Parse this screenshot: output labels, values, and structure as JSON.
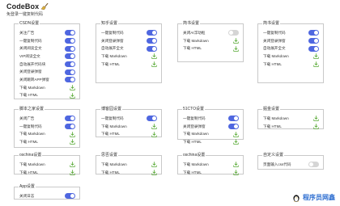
{
  "app": {
    "title": "CodeBox",
    "subtitle": "免登录一键复制代码"
  },
  "icons": {
    "logo": "broom-icon",
    "download": "download-icon",
    "brand": "penguin-icon"
  },
  "colors": {
    "toggle_on": "#4f67e0",
    "toggle_off": "#d5d5d5",
    "download": "#55a832",
    "brand": "#2f6fd1"
  },
  "cards": [
    {
      "title": "CSDN设置",
      "rows": [
        {
          "label": "关注广告",
          "type": "toggle",
          "on": true
        },
        {
          "label": "一键复制代码",
          "type": "toggle",
          "on": true
        },
        {
          "label": "关闭阅读全文",
          "type": "toggle",
          "on": true
        },
        {
          "label": "VIP阅读全文",
          "type": "toggle",
          "on": true
        },
        {
          "label": "自动展开代码块",
          "type": "toggle",
          "on": true
        },
        {
          "label": "关闭登录弹窗",
          "type": "toggle",
          "on": true
        },
        {
          "label": "关闭跳转APP弹窗",
          "type": "toggle",
          "on": true
        },
        {
          "label": "下载 Markdown",
          "type": "download"
        },
        {
          "label": "下载 HTML",
          "type": "download"
        }
      ]
    },
    {
      "title": "知乎设置",
      "rows": [
        {
          "label": "一键复制代码",
          "type": "toggle",
          "on": true
        },
        {
          "label": "关闭登录弹窗",
          "type": "toggle",
          "on": true
        },
        {
          "label": "自动展开全文",
          "type": "toggle",
          "on": true
        },
        {
          "label": "下载 Markdown",
          "type": "download"
        },
        {
          "label": "下载 HTML",
          "type": "download"
        }
      ]
    },
    {
      "title": "简书设置",
      "rows": [
        {
          "label": "关闭AI浮动框",
          "type": "toggle",
          "on": false
        },
        {
          "label": "下载 Markdown",
          "type": "download"
        },
        {
          "label": "下载 HTML",
          "type": "download"
        }
      ]
    },
    {
      "title": "简书设置",
      "rows": [
        {
          "label": "一键复制代码",
          "type": "toggle",
          "on": true
        },
        {
          "label": "关闭登录弹窗",
          "type": "toggle",
          "on": true
        },
        {
          "label": "自动展开全文",
          "type": "toggle",
          "on": true
        },
        {
          "label": "下载 Markdown",
          "type": "download"
        },
        {
          "label": "下载 HTML",
          "type": "download"
        }
      ]
    },
    {
      "title": "脚本之家设置",
      "rows": [
        {
          "label": "关闭广告",
          "type": "toggle",
          "on": true
        },
        {
          "label": "一键复制代码",
          "type": "toggle",
          "on": true
        },
        {
          "label": "下载 Markdown",
          "type": "download"
        },
        {
          "label": "下载 HTML",
          "type": "download"
        }
      ]
    },
    {
      "title": "博客园设置",
      "rows": [
        {
          "label": "一键复制代码",
          "type": "toggle",
          "on": true
        },
        {
          "label": "下载 Markdown",
          "type": "download"
        },
        {
          "label": "下载 HTML",
          "type": "download"
        }
      ]
    },
    {
      "title": "51CTO设置",
      "rows": [
        {
          "label": "一键复制代码",
          "type": "toggle",
          "on": true
        },
        {
          "label": "关闭登录弹窗",
          "type": "toggle",
          "on": true
        },
        {
          "label": "下载 Markdown",
          "type": "download"
        },
        {
          "label": "下载 HTML",
          "type": "download"
        }
      ]
    },
    {
      "title": "掘金设置",
      "rows": [
        {
          "label": "下载 Markdown",
          "type": "download"
        },
        {
          "label": "下载 HTML",
          "type": "download"
        }
      ]
    },
    {
      "title": "oschina设置",
      "rows": [
        {
          "label": "下载 Markdown",
          "type": "download"
        },
        {
          "label": "下载 HTML",
          "type": "download"
        }
      ]
    },
    {
      "title": "思否设置",
      "rows": [
        {
          "label": "下载 Markdown",
          "type": "download"
        },
        {
          "label": "下载 HTML",
          "type": "download"
        }
      ]
    },
    {
      "title": "oschina设置",
      "rows": [
        {
          "label": "下载 Markdown",
          "type": "download"
        },
        {
          "label": "下载 HTML",
          "type": "download"
        }
      ]
    },
    {
      "title": "自定义设置",
      "rows": [
        {
          "label": "页面输入css代码",
          "type": "toggle",
          "on": false
        }
      ]
    },
    {
      "title": "App设置",
      "rows": [
        {
          "label": "关闭日志",
          "type": "toggle",
          "on": true
        }
      ]
    }
  ],
  "brand": {
    "text": "程序员网鑫"
  }
}
